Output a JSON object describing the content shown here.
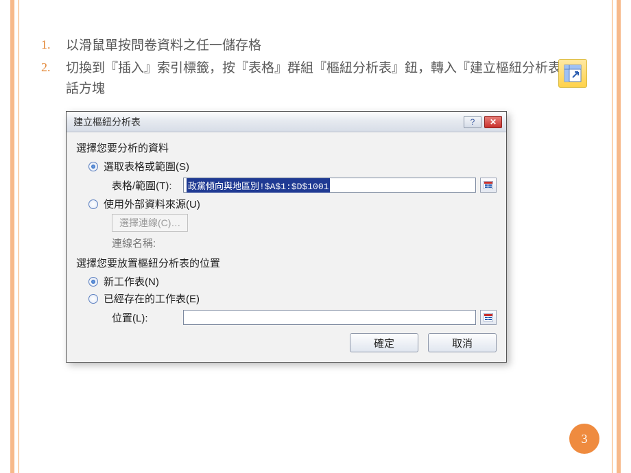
{
  "steps": [
    "以滑鼠單按問卷資料之任一儲存格",
    "切換到『插入』索引標籤，按『表格』群組『樞紐分析表』鈕，轉入『建立樞紐分析表』對話方塊"
  ],
  "dialog": {
    "title": "建立樞紐分析表",
    "section_data": "選擇您要分析的資料",
    "opt_select_range": "選取表格或範圍(S)",
    "range_label": "表格/範圍(T):",
    "range_value": "政黨傾向與地區別!$A$1:$D$1001",
    "opt_external": "使用外部資料來源(U)",
    "choose_conn": "選擇連線(C)…",
    "conn_name": "連線名稱:",
    "section_place": "選擇您要放置樞紐分析表的位置",
    "opt_new_sheet": "新工作表(N)",
    "opt_existing": "已經存在的工作表(E)",
    "loc_label": "位置(L):",
    "ok": "確定",
    "cancel": "取消"
  },
  "page_number": "3"
}
